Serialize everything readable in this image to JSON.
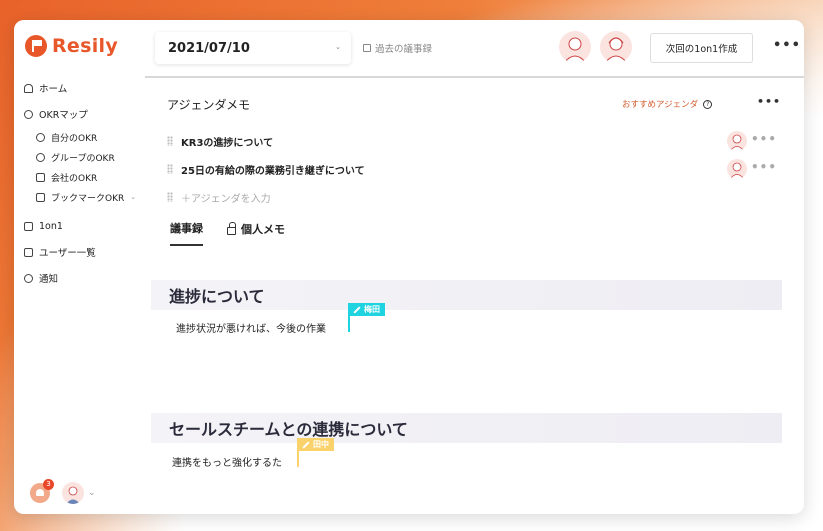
{
  "app": {
    "logo_text": "Resily",
    "brand_color": "#e8572a"
  },
  "sidebar": {
    "items": [
      {
        "label": "ホーム",
        "icon": "home-icon"
      },
      {
        "label": "OKRマップ",
        "icon": "okr-map-icon"
      },
      {
        "label": "1on1",
        "icon": "chat-icon"
      },
      {
        "label": "ユーザー一覧",
        "icon": "users-icon"
      },
      {
        "label": "通知",
        "icon": "bell-icon"
      }
    ],
    "sub_items": [
      {
        "label": "自分のOKR",
        "icon": "person-icon"
      },
      {
        "label": "グループのOKR",
        "icon": "group-icon"
      },
      {
        "label": "会社のOKR",
        "icon": "building-icon"
      },
      {
        "label": "ブックマークOKR",
        "icon": "bookmark-icon"
      }
    ],
    "notification_count": "3"
  },
  "header": {
    "date": "2021/07/10",
    "past_minutes_link": "過去の議事録",
    "next_button": "次回の1on1作成"
  },
  "agenda": {
    "title": "アジェンダメモ",
    "recommend_label": "おすすめアジェンダ",
    "help_mark": "?",
    "items": [
      {
        "text": "KR3の進捗について"
      },
      {
        "text": "25日の有給の際の業務引き継ぎについて"
      }
    ],
    "add_placeholder": "＋アジェンダを入力"
  },
  "tabs": {
    "minutes": "議事録",
    "personal_memo": "個人メモ"
  },
  "sections": [
    {
      "heading": "進捗について",
      "body": "進捗状況が悪ければ、今後の作業",
      "cursor_user": "梅田",
      "cursor_color": "#20d3e0"
    },
    {
      "heading": "セールスチームとの連携について",
      "body": "連携をもっと強化するた",
      "cursor_user": "田中",
      "cursor_color": "#f9d26b"
    }
  ]
}
